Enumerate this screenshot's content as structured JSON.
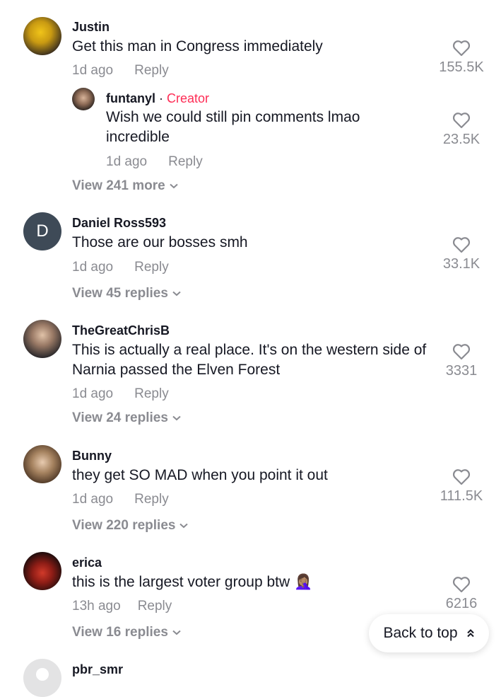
{
  "comments": [
    {
      "username": "Justin",
      "text": "Get this man in Congress immediately",
      "time": "1d ago",
      "reply_label": "Reply",
      "likes": "155.5K",
      "avatar_icon": "user-photo-icon",
      "reply": {
        "username": "funtanyl",
        "separator": "·",
        "badge": "Creator",
        "text": "Wish we could still pin comments lmao incredible",
        "time": "1d ago",
        "reply_label": "Reply",
        "likes": "23.5K"
      },
      "view_more": "View 241 more"
    },
    {
      "username": "Daniel Ross593",
      "avatar_letter": "D",
      "text": "Those are our bosses smh",
      "time": "1d ago",
      "reply_label": "Reply",
      "likes": "33.1K",
      "view_more": "View 45 replies"
    },
    {
      "username": "TheGreatChrisB",
      "text": "This is actually a real place. It's on the western side of Narnia passed the Elven Forest",
      "time": "1d ago",
      "reply_label": "Reply",
      "likes": "3331",
      "view_more": "View 24 replies"
    },
    {
      "username": "Bunny",
      "text": "they get SO MAD when you point it out",
      "time": "1d ago",
      "reply_label": "Reply",
      "likes": "111.5K",
      "view_more": "View 220 replies"
    },
    {
      "username": "erica",
      "text": "this is the largest voter group btw",
      "emoji": "🤦🏽‍♀️",
      "time": "13h ago",
      "reply_label": "Reply",
      "likes": "6216",
      "view_more": "View 16 replies"
    },
    {
      "username": "pbr_smr"
    }
  ],
  "back_to_top": {
    "label": "Back to top",
    "icon": "double-chevron-up-icon"
  },
  "colors": {
    "creator": "#fe2c55",
    "secondary_text": "#8a8b91",
    "primary_text": "#161823"
  }
}
